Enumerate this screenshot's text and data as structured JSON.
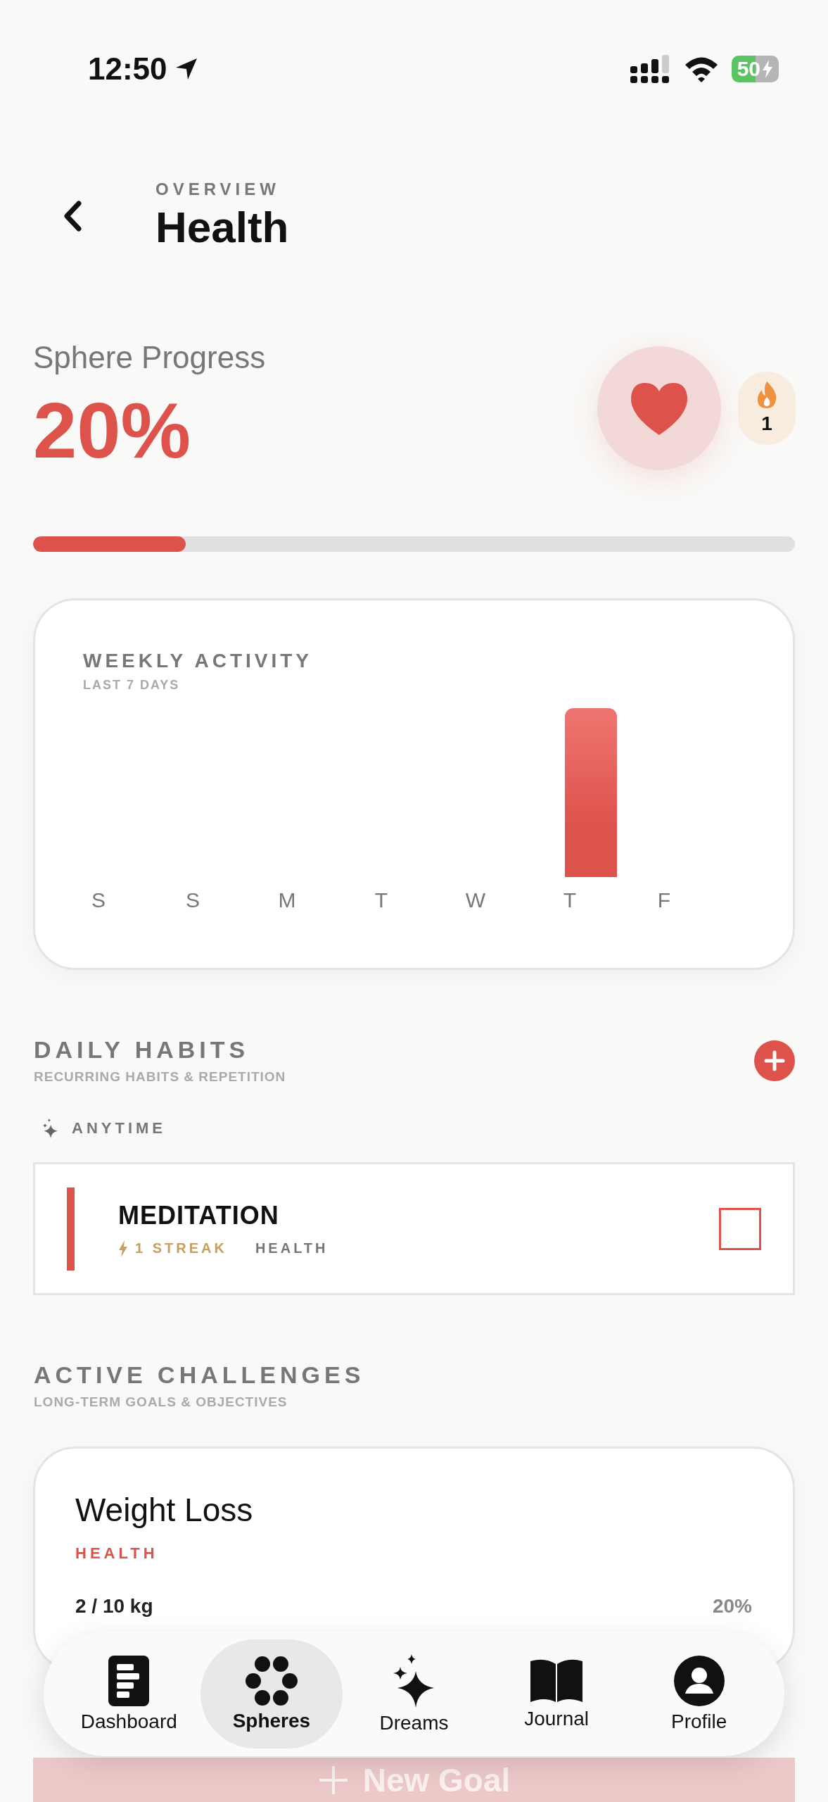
{
  "status_bar": {
    "time": "12:50",
    "battery": "50"
  },
  "header": {
    "eyebrow": "OVERVIEW",
    "title": "Health"
  },
  "progress": {
    "label": "Sphere Progress",
    "value": "20%",
    "level": 0.2,
    "streak": "1"
  },
  "weekly_activity": {
    "title": "WEEKLY ACTIVITY",
    "subtitle": "LAST 7 DAYS",
    "days": [
      {
        "label": "S",
        "active": false
      },
      {
        "label": "S",
        "active": false
      },
      {
        "label": "M",
        "active": false
      },
      {
        "label": "T",
        "active": false
      },
      {
        "label": "W",
        "active": false
      },
      {
        "label": "T",
        "active": true
      },
      {
        "label": "F",
        "active": false
      }
    ]
  },
  "habits": {
    "title": "DAILY HABITS",
    "subtitle": "RECURRING HABITS & REPETITION",
    "group": "ANYTIME",
    "items": [
      {
        "name": "MEDITATION",
        "streak": "1 STREAK",
        "sphere": "HEALTH",
        "checked": false
      }
    ]
  },
  "challenges": {
    "title": "ACTIVE CHALLENGES",
    "subtitle": "LONG-TERM GOALS & OBJECTIVES",
    "items": [
      {
        "name": "Weight Loss",
        "sphere": "HEALTH",
        "amount": "2 / 10 kg",
        "percent": "20%"
      }
    ]
  },
  "new_goal": "New Goal",
  "tabs": [
    {
      "label": "Dashboard",
      "kind": "dashboard",
      "selected": false
    },
    {
      "label": "Spheres",
      "kind": "spheres",
      "selected": true
    },
    {
      "label": "Dreams",
      "kind": "dreams",
      "selected": false
    },
    {
      "label": "Journal",
      "kind": "journal",
      "selected": false
    },
    {
      "label": "Profile",
      "kind": "profile",
      "selected": false
    }
  ]
}
